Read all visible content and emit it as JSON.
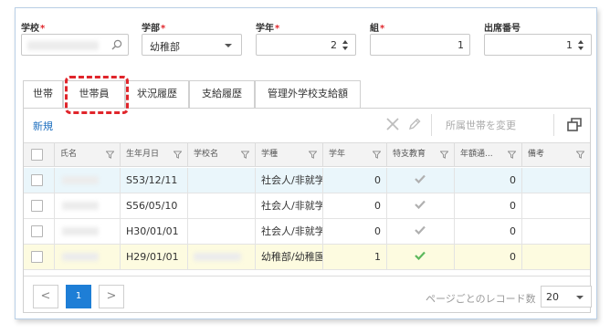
{
  "form": {
    "school": {
      "label": "学校",
      "required_mark": "*",
      "value": ""
    },
    "department": {
      "label": "学部",
      "required_mark": "*",
      "value": "幼稚部"
    },
    "grade": {
      "label": "学年",
      "required_mark": "*",
      "value": "2"
    },
    "class": {
      "label": "組",
      "required_mark": "*",
      "value": "1"
    },
    "attendance_no": {
      "label": "出席番号",
      "value": "1"
    }
  },
  "tabs": [
    {
      "label": "世帯"
    },
    {
      "label": "世帯員"
    },
    {
      "label": "状況履歴"
    },
    {
      "label": "支給履歴"
    },
    {
      "label": "管理外学校支給額"
    }
  ],
  "toolbar": {
    "new_label": "新規",
    "change_household_label": "所属世帯を変更"
  },
  "grid": {
    "columns": [
      "氏名",
      "生年月日",
      "学校名",
      "学種",
      "学年",
      "特支教育",
      "年額通...",
      "備考"
    ],
    "rows": [
      {
        "birth": "S53/12/11",
        "type": "社会人/非就学",
        "grade": "0",
        "special": "gray",
        "annual": "0"
      },
      {
        "birth": "S56/05/10",
        "type": "社会人/非就学",
        "grade": "0",
        "special": "gray",
        "annual": "0"
      },
      {
        "birth": "H30/01/01",
        "type": "社会人/非就学",
        "grade": "0",
        "special": "gray",
        "annual": "0"
      },
      {
        "birth": "H29/01/01",
        "type": "幼稚部/幼稚園",
        "grade": "1",
        "special": "green",
        "annual": "0"
      }
    ]
  },
  "pager": {
    "prev": "<",
    "current_page": "1",
    "next": ">",
    "page_size_label": "ページごとのレコード数",
    "page_size": "20"
  },
  "colors": {
    "accent": "#1e7ed6",
    "link": "#1e6fbf",
    "required": "#e0252b",
    "row_alt": "#eaf6fb",
    "row_selected": "#fdfbe0",
    "check_green": "#5cb85c",
    "check_gray": "#b0b0b0"
  }
}
